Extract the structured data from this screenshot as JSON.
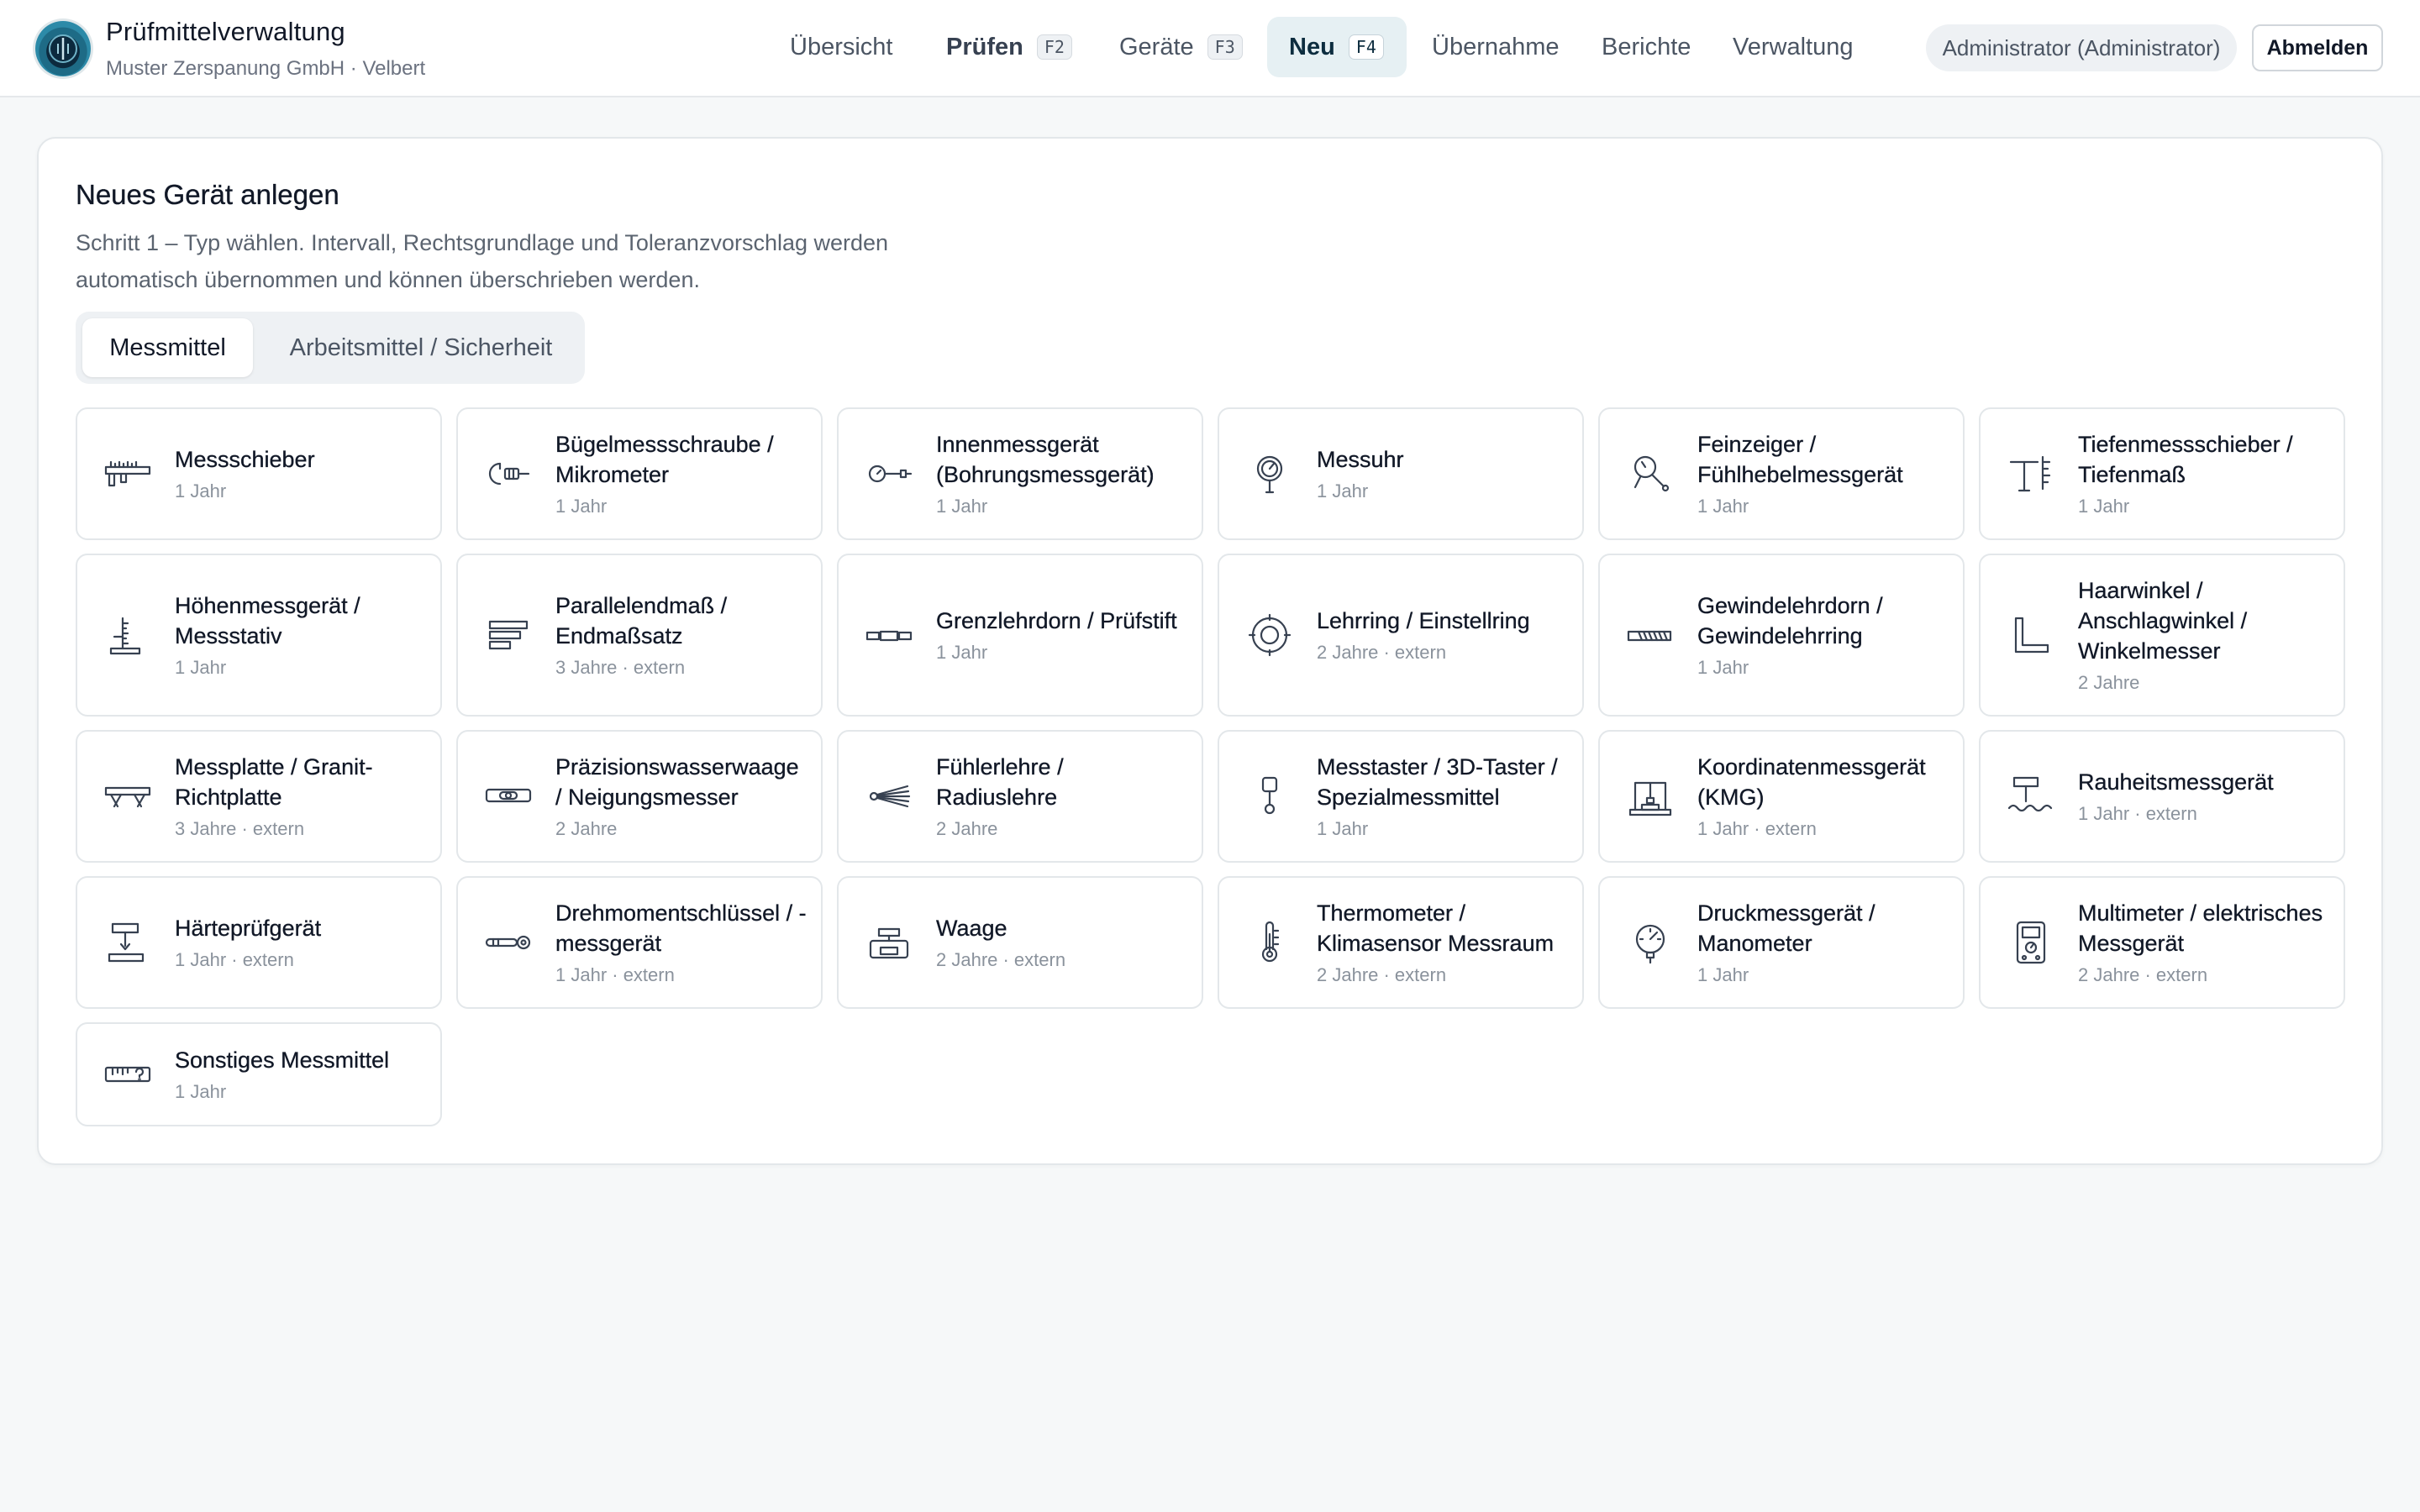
{
  "app": {
    "title": "Prüfmittelverwaltung",
    "subtitle": "Muster Zerspanung GmbH · Velbert"
  },
  "nav": [
    {
      "label": "Übersicht",
      "shortcut": ""
    },
    {
      "label": "Prüfen",
      "shortcut": "F2"
    },
    {
      "label": "Geräte",
      "shortcut": "F3"
    },
    {
      "label": "Neu",
      "shortcut": "F4"
    },
    {
      "label": "Übernahme",
      "shortcut": ""
    },
    {
      "label": "Berichte",
      "shortcut": ""
    },
    {
      "label": "Verwaltung",
      "shortcut": ""
    }
  ],
  "nav_active": "Neu",
  "user": {
    "name": "Administrator (Administrator)",
    "logout_label": "Abmelden"
  },
  "page": {
    "title": "Neues Gerät anlegen",
    "description": "Schritt 1 – Typ wählen. Intervall, Rechtsgrundlage und Toleranzvorschlag werden automatisch übernommen und können überschrieben werden.",
    "tabs": [
      {
        "label": "Messmittel",
        "selected": true
      },
      {
        "label": "Arbeitsmittel / Sicherheit",
        "selected": false
      }
    ]
  },
  "device_types": [
    {
      "name": "Messschieber",
      "interval": "1 Jahr",
      "icon": "caliper-icon"
    },
    {
      "name": "Bügelmessschraube / Mikrometer",
      "interval": "1 Jahr",
      "icon": "micrometer-icon"
    },
    {
      "name": "Innenmessgerät (Bohrungsmessgerät)",
      "interval": "1 Jahr",
      "icon": "bore-gauge-icon"
    },
    {
      "name": "Messuhr",
      "interval": "1 Jahr",
      "icon": "dial-indicator-icon"
    },
    {
      "name": "Feinzeiger / Fühlhebelmessgerät",
      "interval": "1 Jahr",
      "icon": "lever-indicator-icon"
    },
    {
      "name": "Tiefenmessschieber / Tiefenmaß",
      "interval": "1 Jahr",
      "icon": "depth-gauge-icon"
    },
    {
      "name": "Höhenmessgerät / Messstativ",
      "interval": "1 Jahr",
      "icon": "height-gauge-icon"
    },
    {
      "name": "Parallelendmaß / Endmaßsatz",
      "interval": "3 Jahre · extern",
      "icon": "gauge-block-icon"
    },
    {
      "name": "Grenzlehrdorn / Prüfstift",
      "interval": "1 Jahr",
      "icon": "plug-gauge-icon"
    },
    {
      "name": "Lehrring / Einstellring",
      "interval": "2 Jahre · extern",
      "icon": "ring-gauge-icon"
    },
    {
      "name": "Gewindelehrdorn / Gewindelehrring",
      "interval": "1 Jahr",
      "icon": "thread-gauge-icon"
    },
    {
      "name": "Haarwinkel / Anschlagwinkel / Winkelmesser",
      "interval": "2 Jahre",
      "icon": "square-icon"
    },
    {
      "name": "Messplatte / Granit-Richtplatte",
      "interval": "3 Jahre · extern",
      "icon": "surface-plate-icon"
    },
    {
      "name": "Präzisionswasserwaage / Neigungsmesser",
      "interval": "2 Jahre",
      "icon": "spirit-level-icon"
    },
    {
      "name": "Fühlerlehre / Radiuslehre",
      "interval": "2 Jahre",
      "icon": "feeler-gauge-icon"
    },
    {
      "name": "Messtaster / 3D-Taster / Spezialmessmittel",
      "interval": "1 Jahr",
      "icon": "probe-icon"
    },
    {
      "name": "Koordinatenmessgerät (KMG)",
      "interval": "1 Jahr · extern",
      "icon": "cmm-icon"
    },
    {
      "name": "Rauheitsmessgerät",
      "interval": "1 Jahr · extern",
      "icon": "roughness-icon"
    },
    {
      "name": "Härteprüfgerät",
      "interval": "1 Jahr · extern",
      "icon": "hardness-tester-icon"
    },
    {
      "name": "Drehmomentschlüssel / -messgerät",
      "interval": "1 Jahr · extern",
      "icon": "torque-wrench-icon"
    },
    {
      "name": "Waage",
      "interval": "2 Jahre · extern",
      "icon": "scale-icon"
    },
    {
      "name": "Thermometer / Klimasensor Messraum",
      "interval": "2 Jahre · extern",
      "icon": "thermometer-icon"
    },
    {
      "name": "Druckmessgerät / Manometer",
      "interval": "1 Jahr",
      "icon": "pressure-gauge-icon"
    },
    {
      "name": "Multimeter / elektrisches Messgerät",
      "interval": "2 Jahre · extern",
      "icon": "multimeter-icon"
    },
    {
      "name": "Sonstiges Messmittel",
      "interval": "1 Jahr",
      "icon": "ruler-question-icon"
    }
  ]
}
